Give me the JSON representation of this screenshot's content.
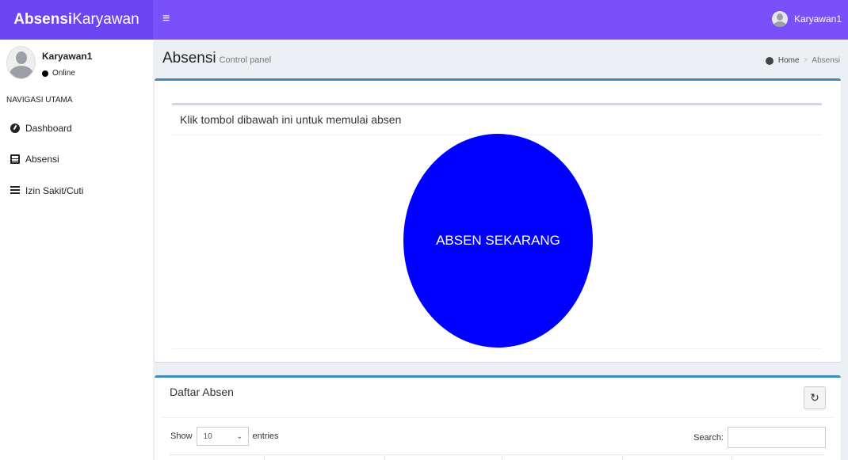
{
  "header": {
    "logo_bold": "Absensi",
    "logo_light": "Karyawan",
    "toggle_glyph": "≡",
    "user_name": "Karyawan1"
  },
  "sidebar": {
    "user_name": "Karyawan1",
    "status": "Online",
    "nav_header": "NAVIGASI UTAMA",
    "items": [
      {
        "label": "Dashboard",
        "icon": "dashboard-icon"
      },
      {
        "label": "Absensi",
        "icon": "list-alt-icon"
      },
      {
        "label": "Izin Sakit/Cuti",
        "icon": "list-icon"
      }
    ]
  },
  "content_header": {
    "title": "Absensi",
    "subtitle": "Control panel",
    "breadcrumb": [
      "Home",
      "Absensi"
    ]
  },
  "absen_box": {
    "instruction": "Klik tombol dibawah ini untuk memulai absen",
    "button_label": "ABSEN SEKARANG",
    "button_color": "#0000ff"
  },
  "daftar_box": {
    "title": "Daftar Absen",
    "refresh_glyph": "↻",
    "show_label": "Show",
    "entries_value": "10",
    "entries_label": "entries",
    "search_label": "Search:",
    "search_value": ""
  },
  "colors": {
    "header": "#7a50fb",
    "logo_bg": "#6c45f2",
    "box_border": "#3c8dbc"
  }
}
